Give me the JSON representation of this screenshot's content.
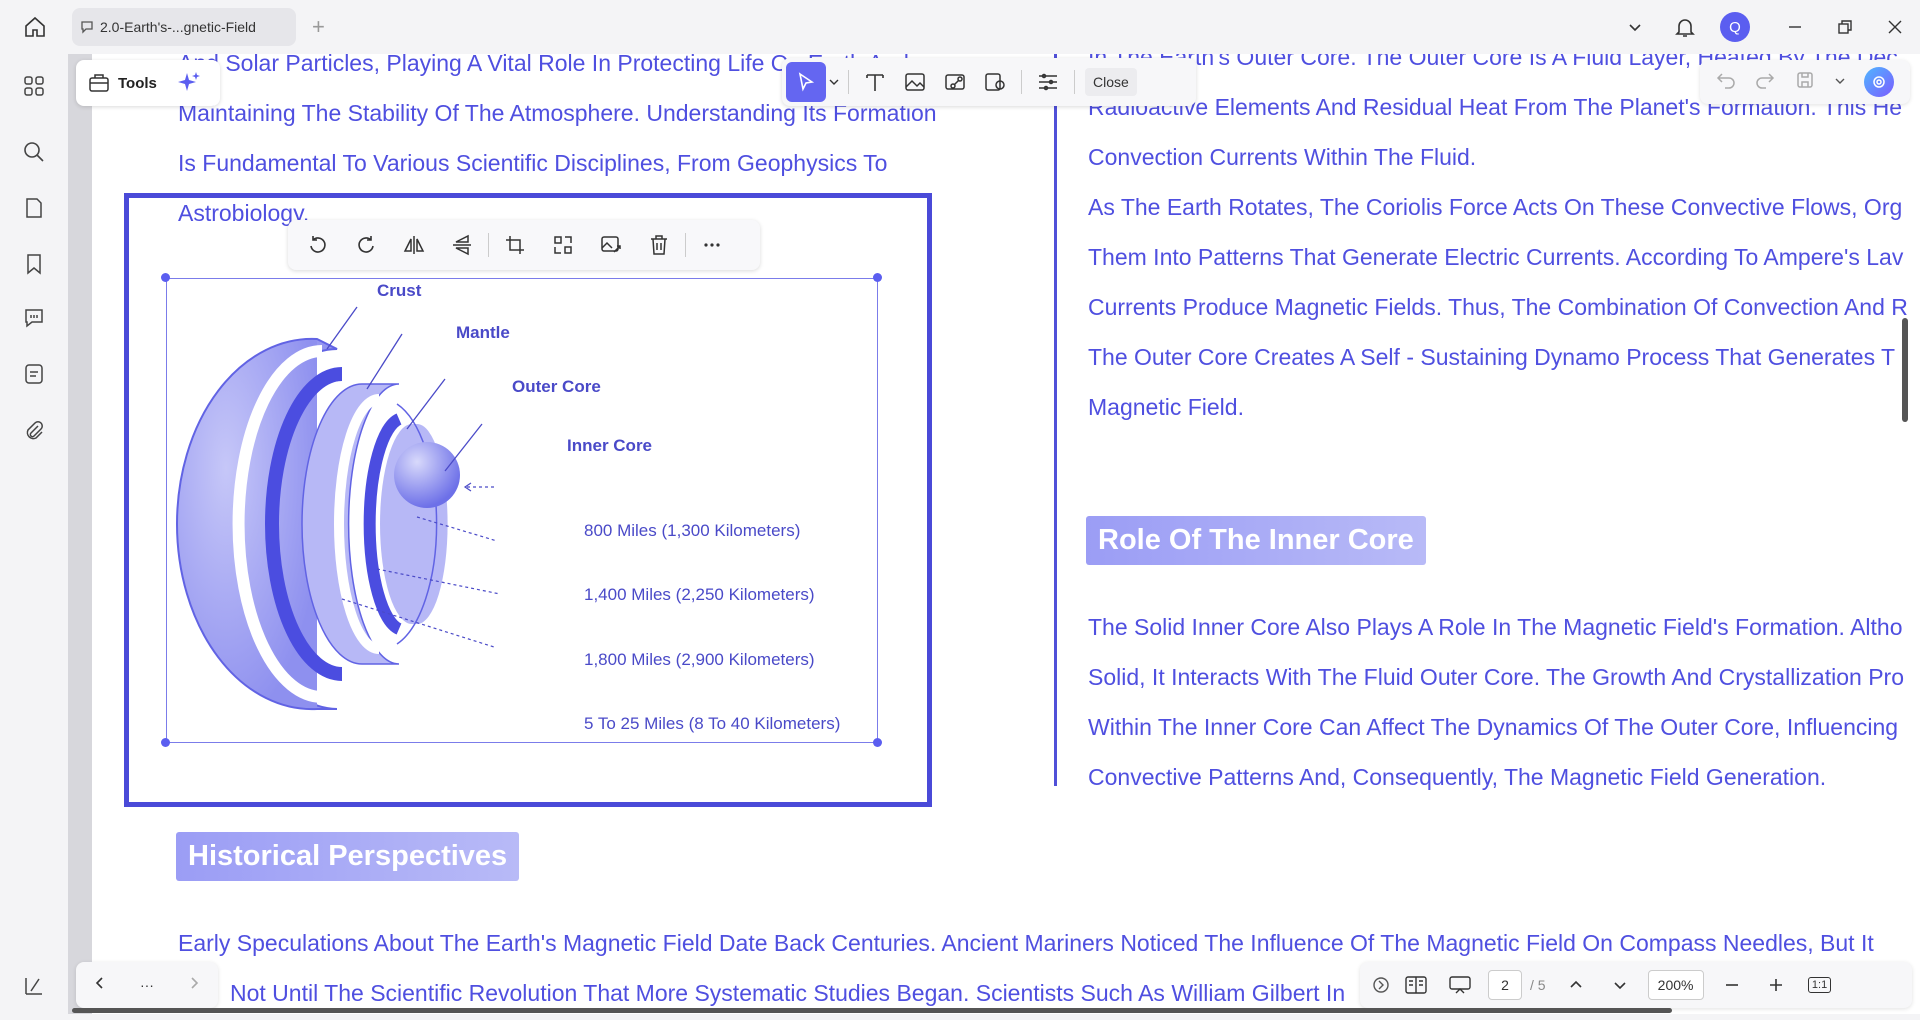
{
  "titlebar": {
    "tab_title": "2.0-Earth's-...gnetic-Field",
    "avatar_letter": "Q"
  },
  "toolbar": {
    "tools_label": "Tools",
    "close_label": "Close"
  },
  "document": {
    "left_column_top": [
      "And Solar Particles, Playing A Vital Role In Protecting Life On Earth And",
      "Maintaining The Stability Of The Atmosphere. Understanding Its Formation",
      "Is Fundamental To Various Scientific Disciplines, From Geophysics To",
      "Astrobiology."
    ],
    "right_column_top": [
      "In The Earth's Outer Core. The Outer Core Is A Fluid Layer, Heated By The Dec",
      "Radioactive Elements And Residual Heat From The Planet's Formation. This He",
      "Convection Currents Within The Fluid.",
      "As The Earth Rotates, The Coriolis Force Acts On These Convective Flows, Org",
      "Them Into Patterns That Generate Electric Currents. According To Ampere's Lav",
      "Currents Produce Magnetic Fields. Thus, The Combination Of Convection And R",
      "The Outer Core Creates A Self - Sustaining Dynamo Process That Generates T",
      "Magnetic Field."
    ],
    "inner_core_heading": "Role Of The Inner Core",
    "inner_core_text": [
      "The Solid Inner Core Also Plays A Role In The Magnetic Field's Formation. Altho",
      "Solid, It Interacts With The Fluid Outer Core. The Growth And Crystallization Pro",
      "Within The Inner Core Can Affect The Dynamics Of The Outer Core, Influencing",
      "Convective Patterns And, Consequently, The Magnetic Field Generation."
    ],
    "historical_heading": "Historical Perspectives",
    "historical_text": [
      "Early Speculations About The Earth's Magnetic Field Date Back Centuries. Ancient Mariners Noticed The Influence Of The Magnetic Field On Compass Needles, But It",
      "Not Until The Scientific Revolution That More Systematic Studies Began. Scientists Such As William Gilbert In"
    ]
  },
  "diagram": {
    "labels": {
      "crust": "Crust",
      "mantle": "Mantle",
      "outer_core": "Outer Core",
      "inner_core": "Inner Core"
    },
    "distances": [
      "800 Miles (1,300 Kilometers)",
      "1,400 Miles (2,250 Kilometers)",
      "1,800 Miles (2,900 Kilometers)",
      "5 To 25 Miles (8 To 40 Kilometers)"
    ]
  },
  "status": {
    "current_page": "2",
    "total_pages": "/ 5",
    "zoom": "200%",
    "fit_label": "1:1",
    "more": "···"
  },
  "colors": {
    "accent": "#5b5ef0",
    "text_blue": "#4f4fe0"
  }
}
